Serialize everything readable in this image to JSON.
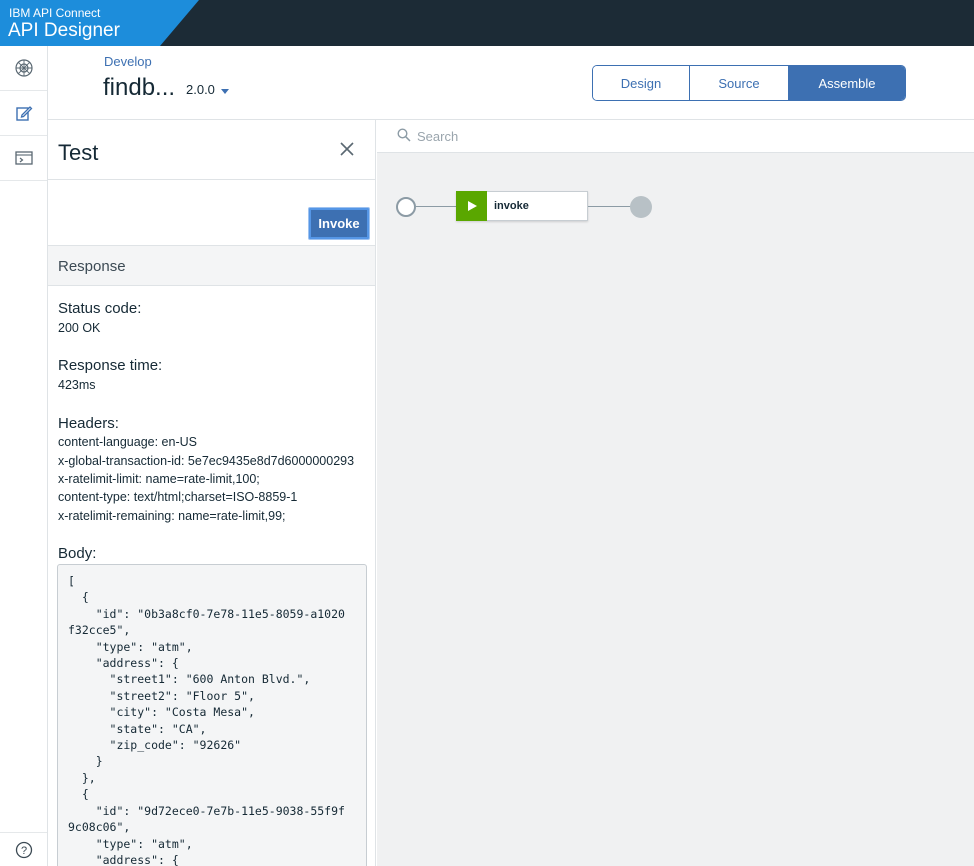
{
  "brand": {
    "small": "IBM API Connect",
    "big": "API Designer"
  },
  "rail": {
    "icons": [
      "product-icon",
      "edit-icon",
      "terminal-icon",
      "help-icon"
    ]
  },
  "header": {
    "breadcrumb": "Develop",
    "api_name": "findb...",
    "version": "2.0.0",
    "tabs": [
      {
        "label": "Design",
        "active": false
      },
      {
        "label": "Source",
        "active": false
      },
      {
        "label": "Assemble",
        "active": true
      }
    ]
  },
  "test_panel": {
    "title": "Test",
    "invoke_label": "Invoke",
    "response_heading": "Response",
    "status_label": "Status code:",
    "status_value": "200 OK",
    "time_label": "Response time:",
    "time_value": "423ms",
    "headers_label": "Headers:",
    "headers": [
      "content-language: en-US",
      "x-global-transaction-id: 5e7ec9435e8d7d6000000293",
      "x-ratelimit-limit: name=rate-limit,100;",
      "content-type: text/html;charset=ISO-8859-1",
      "x-ratelimit-remaining: name=rate-limit,99;"
    ],
    "body_label": "Body:",
    "body_text": "[\n  {\n    \"id\": \"0b3a8cf0-7e78-11e5-8059-a1020\nf32cce5\",\n    \"type\": \"atm\",\n    \"address\": {\n      \"street1\": \"600 Anton Blvd.\",\n      \"street2\": \"Floor 5\",\n      \"city\": \"Costa Mesa\",\n      \"state\": \"CA\",\n      \"zip_code\": \"92626\"\n    }\n  },\n  {\n    \"id\": \"9d72ece0-7e7b-11e5-9038-55f9f\n9c08c06\",\n    \"type\": \"atm\",\n    \"address\": {"
  },
  "canvas": {
    "search_placeholder": "Search",
    "policy_name": "invoke"
  },
  "colors": {
    "header_bg": "#1c2b36",
    "brand_blue": "#1d8ddb",
    "accent": "#3d70b2",
    "policy_green": "#5aa700"
  }
}
